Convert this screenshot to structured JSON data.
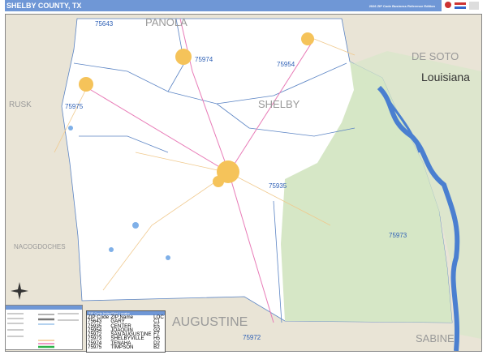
{
  "header": {
    "title": "SHELBY COUNTY, TX",
    "edition": "2026 ZIP Code Business Reference Edition"
  },
  "map": {
    "colors": {
      "background": "#e9e4d6",
      "county": "#ffffff",
      "forest": "#d6e7c6",
      "water": "#4a7fd0",
      "city": "#f5c35a",
      "header": "#6f97d6"
    },
    "zip_labels": [
      "75643",
      "75974",
      "75954",
      "75975",
      "75935",
      "75973",
      "75972"
    ],
    "area_labels": [
      "PANOLA",
      "DE SOTO",
      "Louisiana",
      "RUSK",
      "SHELBY",
      "NACOGDOCHES",
      "AUGUSTINE",
      "SABINE"
    ]
  },
  "zip_table": {
    "title": "ZIP Code Index/Grid Locator",
    "headers": [
      "ZIP Code",
      "ZIP Name",
      "LOC"
    ],
    "rows": [
      [
        "75643",
        "GARY",
        "C1"
      ],
      [
        "75935",
        "CENTER",
        "E5"
      ],
      [
        "75954",
        "JOAQUIN",
        "G2"
      ],
      [
        "75972",
        "SAN AUGUSTINE",
        "F7"
      ],
      [
        "75973",
        "SHELBYVILLE",
        "H5"
      ],
      [
        "75974",
        "TENAHA",
        "D2"
      ],
      [
        "75975",
        "TIMPSON",
        "B2"
      ]
    ]
  }
}
